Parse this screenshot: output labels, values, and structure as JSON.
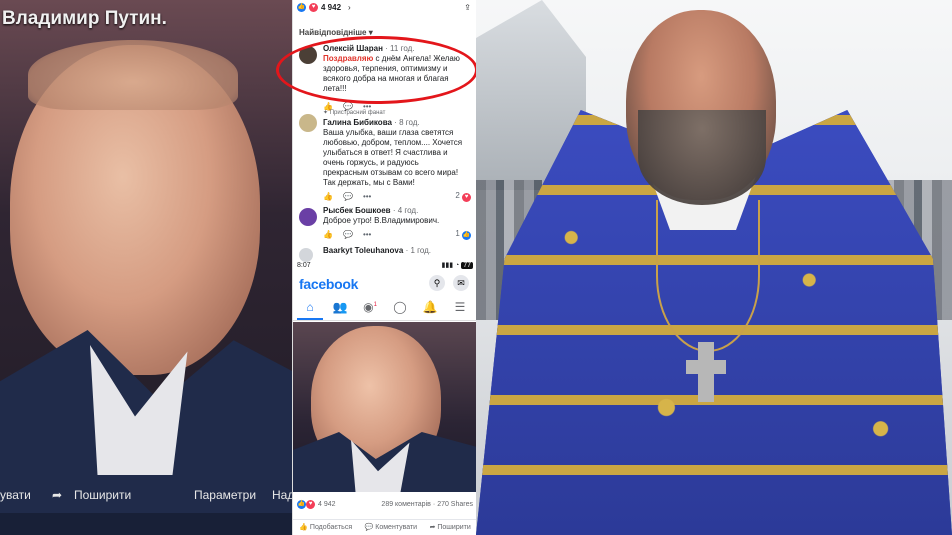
{
  "left_panel": {
    "title": "Владимир Путин.",
    "actions": {
      "comment": "увати",
      "share": "Поширити",
      "params": "Параметри",
      "next": "Над"
    }
  },
  "mid_panel": {
    "reaction_count": "4 942",
    "sort_label": "Найвідповідніше",
    "comments": [
      {
        "name": "Олексій Шаран",
        "time": "· 11 год.",
        "highlight": "Поздравляю",
        "text": " с днём Ангела! Желаю здоровья, терпения, оптимизму и всякого добра на многая и благая лета!!!"
      },
      {
        "badge": "Пристрасний фанат",
        "name": "Галина Бибикова",
        "time": "· 8 год.",
        "text": "Ваша улыбка, ваши глаза светятся любовью, добром, теплом.... Хочется улыбаться в ответ! Я счастлива и очень горжусь, и радуюсь прекрасным отзывам со всего мира! Так держать, мы с Вами!",
        "reactions": "2"
      },
      {
        "name": "Рысбек Бошкоев",
        "time": "· 4 год.",
        "text": "Доброе утро! В.Владимирович.",
        "reactions": "1"
      },
      {
        "name": "Baarkyt Toleuhanova",
        "time": "· 1 год."
      }
    ],
    "statusbar": {
      "time": "8:07",
      "battery": "77"
    },
    "brand": "facebook",
    "notification_badge": "1",
    "post": {
      "reaction_count": "4 942",
      "comments_count": "289 коментарів",
      "shares_count": "270 Shares",
      "like_label": "Подобається",
      "comment_label": "Коментувати",
      "share_label": "Поширити"
    }
  },
  "colors": {
    "facebook_blue": "#1877f2",
    "highlight_red": "#e0342b",
    "circle_red": "#e3161b"
  }
}
